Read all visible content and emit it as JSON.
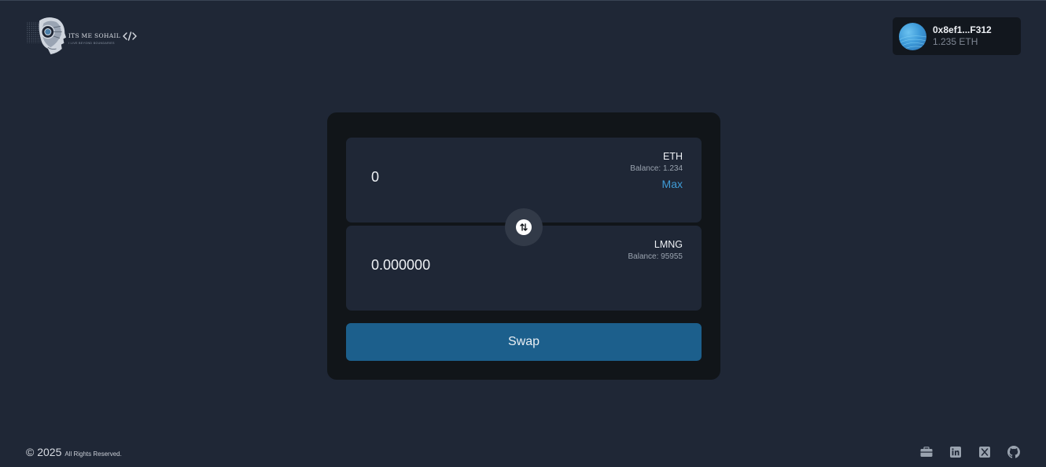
{
  "header": {
    "logo": {
      "text": "ITS ME SOHAIL",
      "subtext": "I LIVE BEYOND BOUNDARIES",
      "icon": "robot-head-logo"
    },
    "wallet": {
      "address": "0x8ef1...F312",
      "balance": "1.235 ETH",
      "icon": "wallet-avatar"
    }
  },
  "swap": {
    "from": {
      "amount": "0",
      "symbol": "ETH",
      "balance": "Balance: 1.234",
      "max_label": "Max"
    },
    "to": {
      "amount": "0.000000",
      "symbol": "LMNG",
      "balance": "Balance: 95955"
    },
    "switch_icon": "swap-arrows-icon",
    "button_label": "Swap"
  },
  "footer": {
    "copyright": "© 2025",
    "rights": "All Rights Reserved.",
    "socials": [
      {
        "name": "portfolio",
        "icon": "briefcase-icon"
      },
      {
        "name": "linkedin",
        "icon": "linkedin-icon"
      },
      {
        "name": "x",
        "icon": "x-icon"
      },
      {
        "name": "github",
        "icon": "github-icon"
      }
    ]
  },
  "colors": {
    "background": "#1f2736",
    "card": "#111519",
    "panel": "#1f2736",
    "accent": "#3f9bd6",
    "button": "#1c5f8c"
  }
}
